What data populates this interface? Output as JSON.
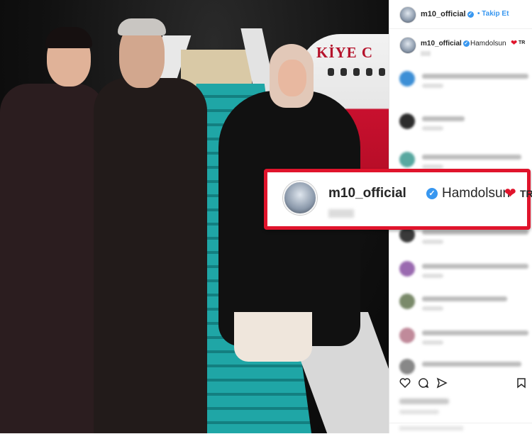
{
  "post": {
    "username": "m10_official",
    "follow_label": "Takip Et",
    "caption_text": "Hamdolsun",
    "caption_flag_label": "TR",
    "accent_color": "#3897f0",
    "heart_color": "#e0142c",
    "heart_icon": "heart-icon",
    "verified_icon": "verified-check-icon"
  },
  "photo": {
    "plane_text": "KİYE C"
  },
  "callout": {
    "username": "m10_official",
    "text": "Hamdolsun",
    "flag_label": "TR",
    "border_color": "#e0142c"
  },
  "comments": {
    "count_visible": 12,
    "blurred": true
  },
  "actions": {
    "icons": [
      "heart-outline-icon",
      "comment-icon",
      "share-icon",
      "bookmark-icon"
    ]
  }
}
